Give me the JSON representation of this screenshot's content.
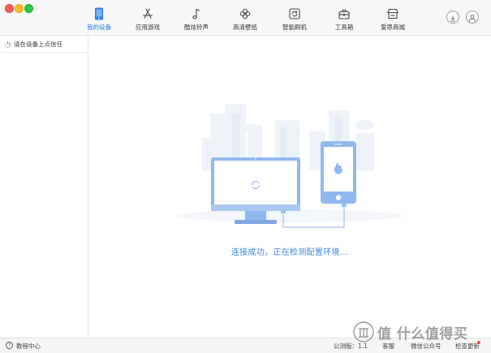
{
  "toolbar": {
    "tabs": [
      {
        "label": "我的设备",
        "icon": "phone-icon",
        "active": true
      },
      {
        "label": "应用游戏",
        "icon": "appstore-icon",
        "active": false
      },
      {
        "label": "酷炫铃声",
        "icon": "music-note-icon",
        "active": false
      },
      {
        "label": "高清壁纸",
        "icon": "flower-icon",
        "active": false
      },
      {
        "label": "智能刷机",
        "icon": "refresh-icon",
        "active": false
      },
      {
        "label": "工具箱",
        "icon": "toolbox-icon",
        "active": false
      },
      {
        "label": "爱思商城",
        "icon": "store-icon",
        "active": false
      }
    ],
    "right_icons": [
      "download-icon",
      "user-icon"
    ]
  },
  "sidebar": {
    "items": [
      {
        "label": "请在设备上点信任",
        "icon": "loading-spinner-icon"
      }
    ]
  },
  "main": {
    "status": "连接成功，正在检测配置环境..."
  },
  "bottombar": {
    "help_label": "教程中心",
    "version_label": "公测版：1.1",
    "service_label": "客服",
    "wechat_label": "微信公众号",
    "update_label": "检查更新"
  },
  "watermark": {
    "text": "值 什么值得买"
  },
  "colors": {
    "accent": "#2b7de9",
    "status_text": "#3d86d9",
    "badge": "#f04a4a"
  }
}
